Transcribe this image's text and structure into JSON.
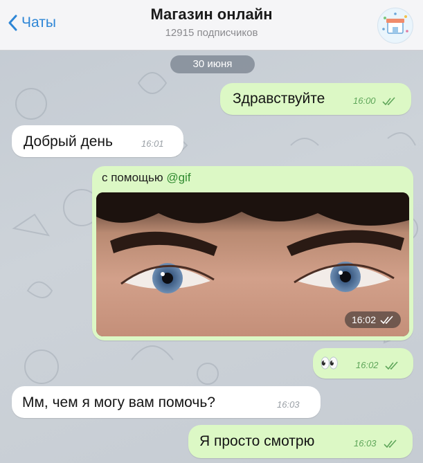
{
  "header": {
    "back_label": "Чаты",
    "title": "Магазин онлайн",
    "subtitle": "12915 подписчиков",
    "avatar_icon": "shop-avatar-icon"
  },
  "date_separator": "30 июня",
  "messages": [
    {
      "direction": "out",
      "text": "Здравствуйте",
      "time": "16:00",
      "status": "read"
    },
    {
      "direction": "in",
      "text": "Добрый день",
      "time": "16:01"
    },
    {
      "direction": "out",
      "type": "gif",
      "caption_prefix": "с помощью ",
      "caption_mention": "@gif",
      "time": "16:02",
      "status": "read"
    },
    {
      "direction": "out",
      "text": "👀",
      "time": "16:02",
      "status": "read"
    },
    {
      "direction": "in",
      "text": "Мм, чем я могу вам помочь?",
      "time": "16:03"
    },
    {
      "direction": "out",
      "text": "Я просто смотрю",
      "time": "16:03",
      "status": "read"
    }
  ],
  "colors": {
    "accent": "#2e86d6",
    "outgoing_bubble": "#dcf8c5",
    "incoming_bubble": "#ffffff",
    "read_ticks": "#5fa65a",
    "mention": "#2f8a2f"
  }
}
